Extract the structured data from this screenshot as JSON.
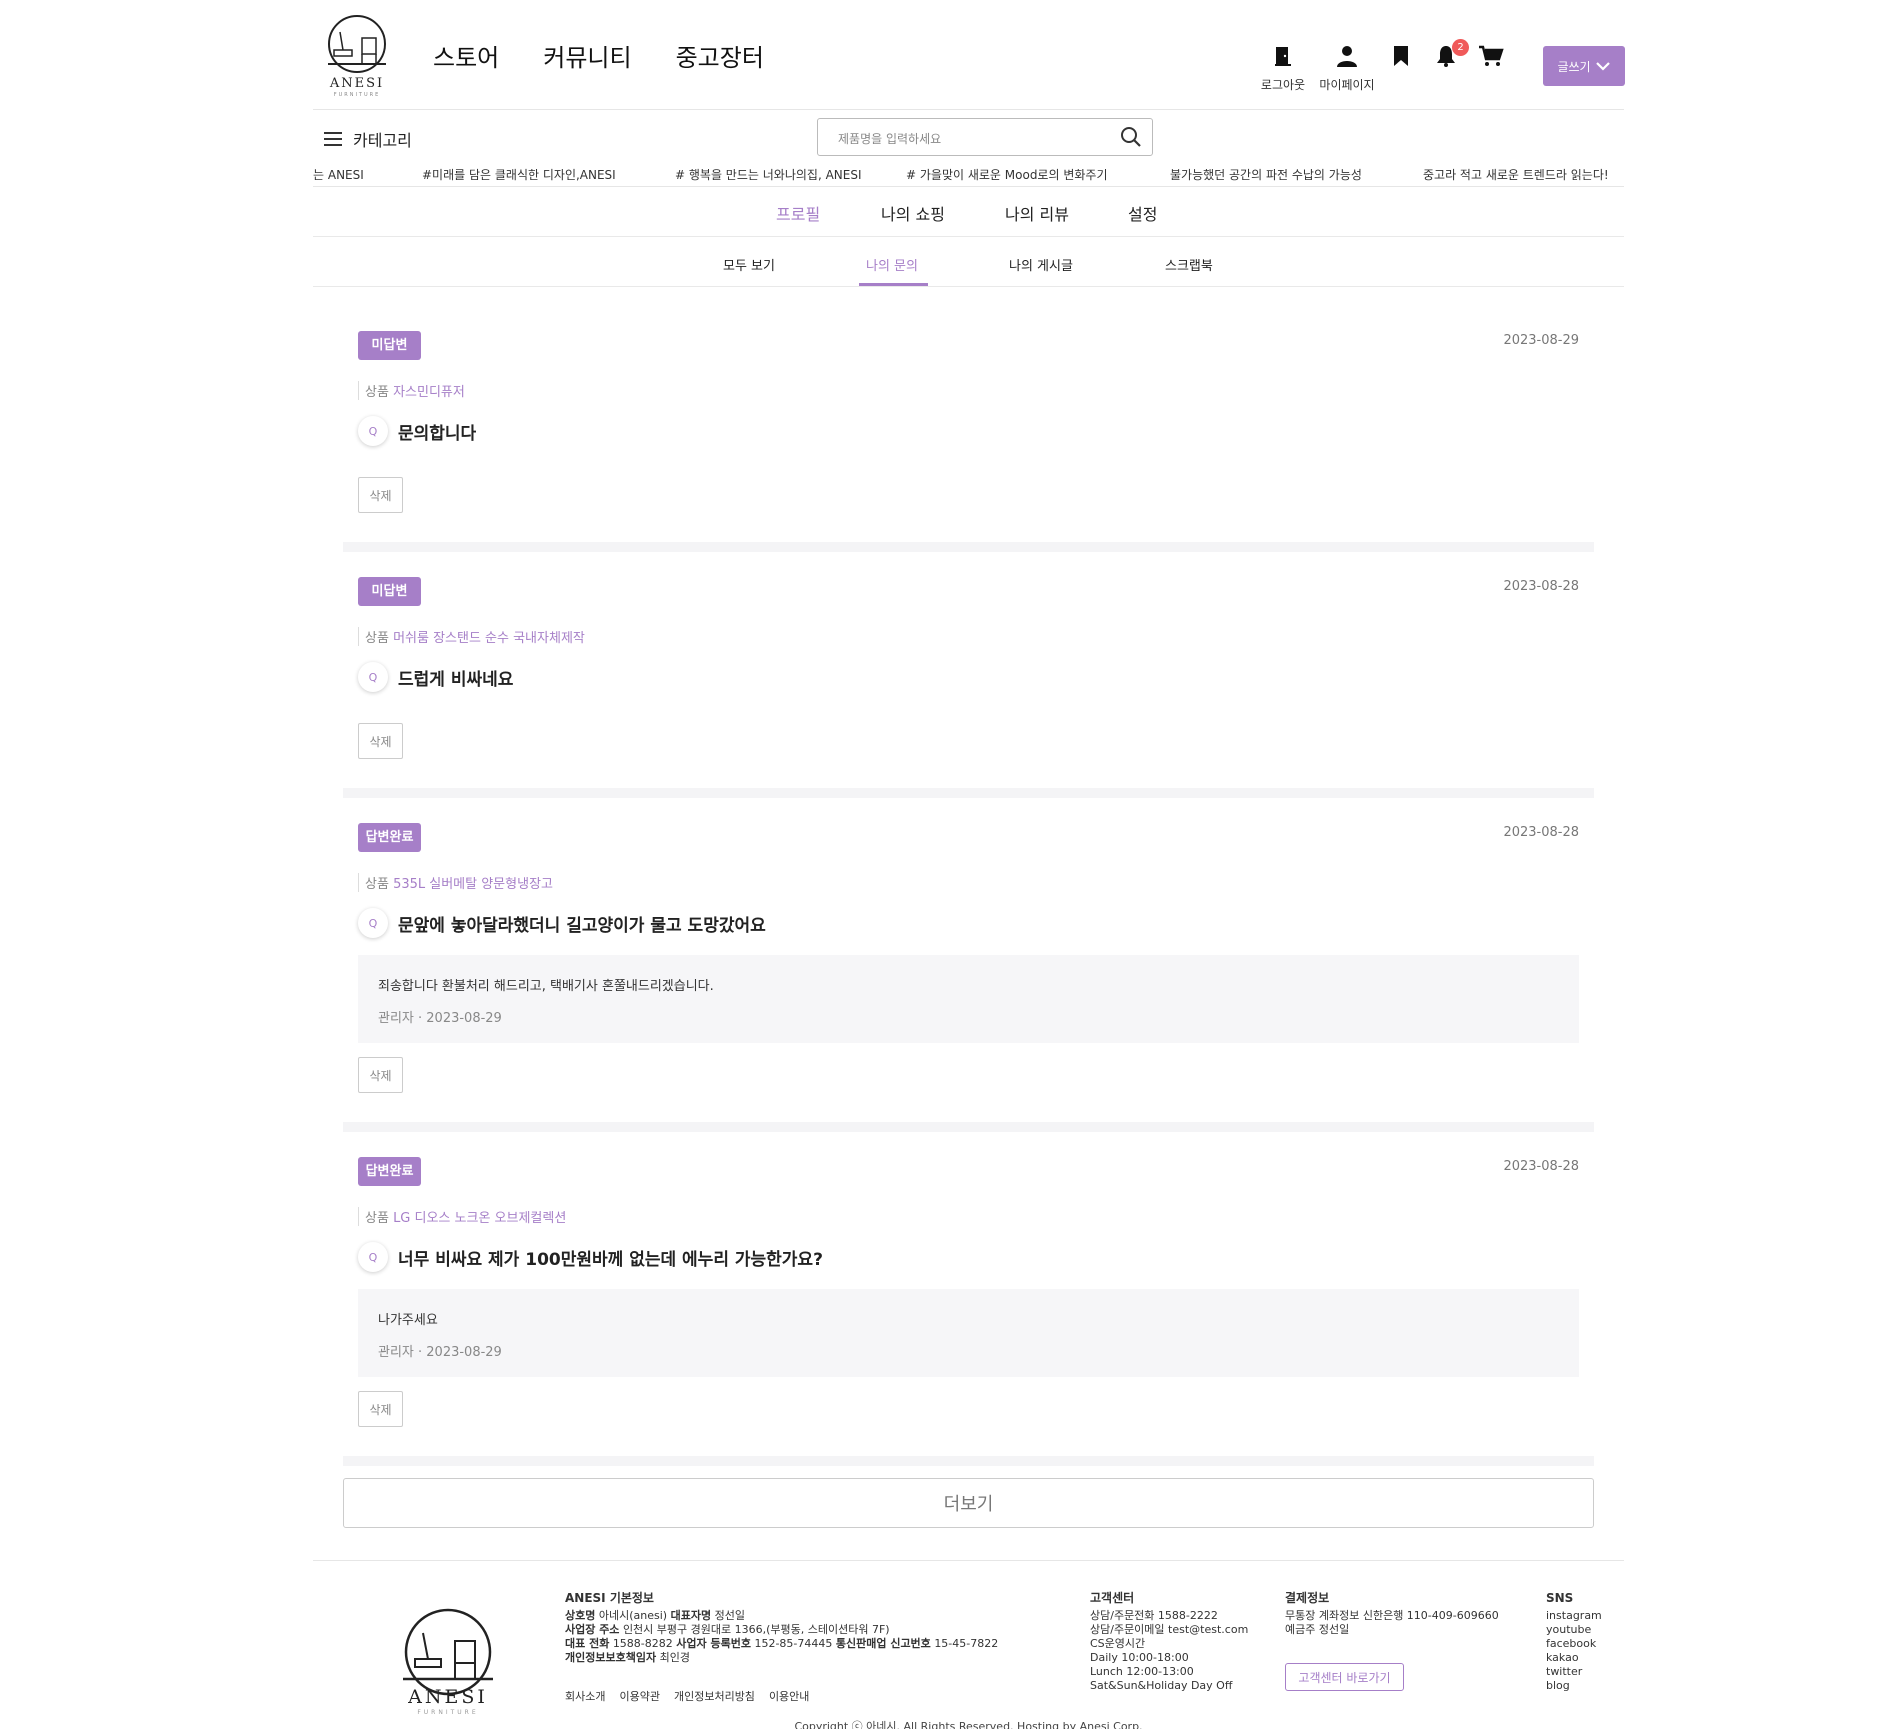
{
  "header": {
    "logo_text": "ANESI",
    "logo_sub": "FURNITURE",
    "nav": [
      "스토어",
      "커뮤니티",
      "중고장터"
    ],
    "icons": {
      "logout": {
        "icon": "logout-door-icon",
        "label": "로그아웃"
      },
      "mypage": {
        "icon": "person-icon",
        "label": "마이페이지"
      },
      "bookmark": {
        "icon": "bookmark-icon"
      },
      "notification": {
        "icon": "bell-icon",
        "badge": "2"
      },
      "cart": {
        "icon": "cart-icon"
      }
    },
    "write_button": "글쓰기"
  },
  "subbar": {
    "category_label": "카테고리",
    "search_placeholder": "제품명을 입력하세요"
  },
  "ticker": [
    "는 ANESI",
    "#미래를 담은 클래식한 디자인,ANESI",
    "# 행복을 만드는 너와나의집, ANESI",
    "# 가을맞이 새로운 Mood로의 변화주기",
    "불가능했던 공간의 파전 수납의 가능성",
    "중고라 적고 새로운 트렌드라 읽는다!"
  ],
  "profile_tabs": [
    "프로필",
    "나의 쇼핑",
    "나의 리뷰",
    "설정"
  ],
  "sub_tabs": [
    "모두 보기",
    "나의 문의",
    "나의 게시글",
    "스크랩북"
  ],
  "inquiries": [
    {
      "status": "미답변",
      "date": "2023-08-29",
      "product_prefix": "상품",
      "product": "자스민디퓨저",
      "question": "문의합니다",
      "delete": "삭제"
    },
    {
      "status": "미답변",
      "date": "2023-08-28",
      "product_prefix": "상품",
      "product": "머쉬룸 장스탠드 순수 국내자체제작",
      "question": "드럽게 비싸네요",
      "delete": "삭제"
    },
    {
      "status": "답변완료",
      "date": "2023-08-28",
      "product_prefix": "상품",
      "product": "535L 실버메탈 양문형냉장고",
      "question": "문앞에 놓아달라했더니 길고양이가 물고 도망갔어요",
      "answer": "죄송합니다 환불처리 해드리고, 택배기사 혼쭐내드리겠습니다.",
      "answer_meta": "관리자 · 2023-08-29",
      "delete": "삭제"
    },
    {
      "status": "답변완료",
      "date": "2023-08-28",
      "product_prefix": "상품",
      "product": "LG 디오스 노크온 오브제컬렉션",
      "question": "너무 비싸요 제가 100만원바께 없는데 에누리 가능한가요?",
      "answer": "나가주세요",
      "answer_meta": "관리자 · 2023-08-29",
      "delete": "삭제"
    }
  ],
  "more_button": "더보기",
  "footer": {
    "logo_text": "ANESI",
    "logo_sub": "FURNITURE",
    "info_title": "ANESI 기본정보",
    "info_lines": [
      {
        "label": "상호명",
        "value": "아네시(anesi)",
        "label2": "대표자명",
        "value2": "정선일"
      },
      {
        "label": "사업장 주소",
        "value": "인천시 부평구 경원대로 1366,(부평동, 스테이션타워 7F)"
      },
      {
        "label": "대표 전화",
        "value": "1588-8282",
        "label2": "사업자 등록번호",
        "value2": "152-85-74445",
        "label3": "통신판매업 신고번호",
        "value3": "15-45-7822"
      },
      {
        "label": "개인정보보호책임자",
        "value": "최인경"
      }
    ],
    "links": [
      "회사소개",
      "이용약관",
      "개인정보처리방침",
      "이용안내"
    ],
    "cs_title": "고객센터",
    "cs_lines": [
      "상담/주문전화 1588-2222",
      "상담/주문이메일 test@test.com",
      "CS운영시간",
      "Daily 10:00-18:00",
      "Lunch 12:00-13:00",
      "Sat&Sun&Holiday Day Off"
    ],
    "pay_title": "결제정보",
    "pay_lines": [
      "무통장 계좌정보 신한은행 110-409-609660",
      "예금주 정선일"
    ],
    "cs_button": "고객센터 바로가기",
    "sns_title": "SNS",
    "sns": [
      "instagram",
      "youtube",
      "facebook",
      "kakao",
      "twitter",
      "blog"
    ],
    "copyright": "Copyright ⓒ 아네시. All Rights Reserved. Hosting by Anesi Corp."
  },
  "colors": {
    "accent": "#a67fc8",
    "badge": "#f05a5a",
    "panel": "#f6f6f8"
  }
}
